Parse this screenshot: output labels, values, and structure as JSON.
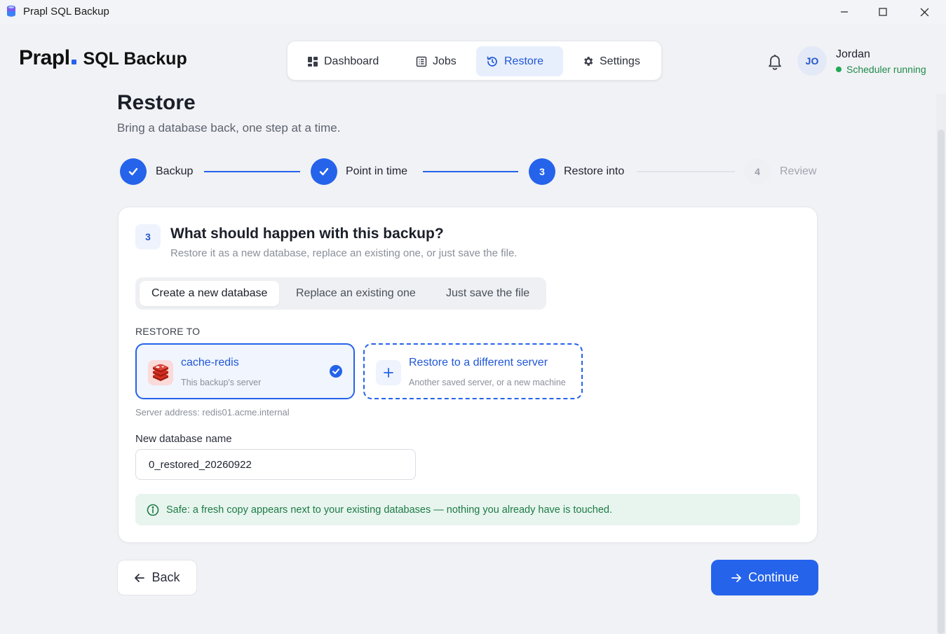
{
  "window": {
    "title": "Prapl SQL Backup"
  },
  "brand": {
    "logo": "Prapl",
    "product": "SQL Backup",
    "accent_color": "#2563eb"
  },
  "nav": {
    "items": [
      {
        "label": "Dashboard",
        "icon": "grid-icon",
        "active": false
      },
      {
        "label": "Jobs",
        "icon": "list-icon",
        "active": false
      },
      {
        "label": "Restore",
        "icon": "history-icon",
        "active": true
      },
      {
        "label": "Settings",
        "icon": "gear-icon",
        "active": false
      }
    ]
  },
  "user": {
    "initials": "JO",
    "name": "Jordan",
    "status": "Scheduler running",
    "status_color": "#1faa55"
  },
  "page": {
    "title": "Restore",
    "subtitle": "Bring a database back, one step at a time."
  },
  "stepper": {
    "steps": [
      {
        "label": "Backup",
        "state": "done",
        "number": "1"
      },
      {
        "label": "Point in time",
        "state": "done",
        "number": "2"
      },
      {
        "label": "Restore into",
        "state": "current",
        "number": "3"
      },
      {
        "label": "Review",
        "state": "pending",
        "number": "4"
      }
    ]
  },
  "card": {
    "step_badge": "3",
    "title": "What should happen with this backup?",
    "subtitle": "Restore it as a new database, replace an existing one, or just save the file.",
    "modes": [
      {
        "label": "Create a new database",
        "active": true
      },
      {
        "label": "Replace an existing one",
        "active": false
      },
      {
        "label": "Just save the file",
        "active": false
      }
    ],
    "restore_to_label": "RESTORE TO",
    "servers": [
      {
        "title": "cache-redis",
        "subtitle": "This backup's server",
        "icon": "redis-icon",
        "selected": true
      },
      {
        "title": "Restore to a different server",
        "subtitle": "Another saved server, or a new machine",
        "icon": "plus-icon",
        "selected": false
      }
    ],
    "server_address": "Server address: redis01.acme.internal",
    "db_name_label": "New database name",
    "db_name_value": "0_restored_20260922",
    "notice": "Safe: a fresh copy appears next to your existing databases — nothing you already have is touched."
  },
  "footer": {
    "back_label": "Back",
    "continue_label": "Continue"
  }
}
